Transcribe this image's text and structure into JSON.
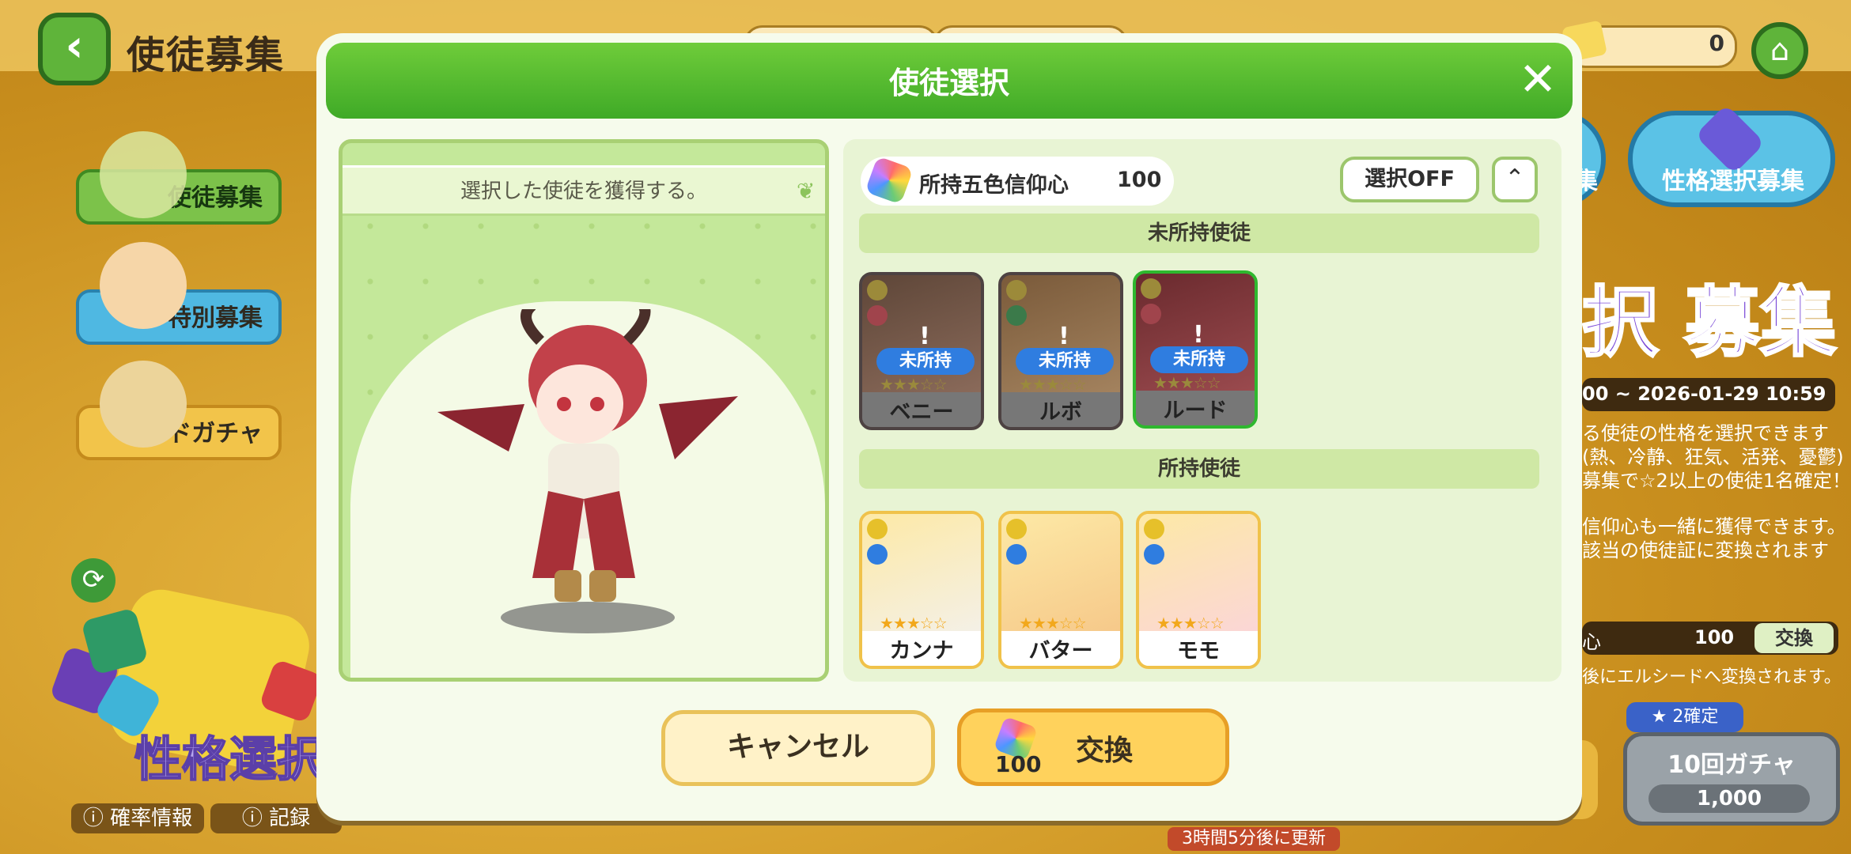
{
  "background": {
    "page_title": "使徒募集",
    "ticket_count": "0",
    "side_tabs": [
      "使徒募集",
      "特別募集",
      "カードガチャ"
    ],
    "gacha_banner_label": "性格選択",
    "bottom_links": [
      "確率情報",
      "記録"
    ],
    "refresh_note": "3時間5分後に更新",
    "right_button_label": "性格選択募集",
    "right_button_partial": "集",
    "big_banner_text": "択 募集",
    "period_text": "00 ~ 2026-01-29 10:59",
    "desc_lines": [
      "る使徒の性格を選択できます",
      "(熱、冷静、狂気、活発、憂鬱)",
      "募集で☆2以上の使徒1名確定！",
      "信仰心も一緒に獲得できます。",
      "該当の使徒証に変換されます"
    ],
    "exchange_row_partial": "心",
    "exchange_value": "100",
    "exchange_button": "交換",
    "convert_note": "後にエルシードへ変換されます。",
    "guarantee_badge": "2確定",
    "ten_gacha_label": "10回ガチャ",
    "ten_gacha_cost": "1,000"
  },
  "modal": {
    "title": "使徒選択",
    "close_icon": "close-icon",
    "preview_caption": "選択した使徒を獲得する。",
    "gem_label": "所持五色信仰心",
    "gem_count": "100",
    "select_off_label": "選択OFF",
    "collapse_icon": "double-chevron-up-icon",
    "unowned_section": "未所持使徒",
    "owned_section": "所持使徒",
    "unowned_badge": "未所持",
    "unowned_cards": [
      {
        "name": "ベニー",
        "stars": "★★★☆☆"
      },
      {
        "name": "ルボ",
        "stars": "★★★☆☆"
      },
      {
        "name": "ルード",
        "stars": "★★★☆☆"
      }
    ],
    "owned_cards": [
      {
        "name": "カンナ",
        "stars": "★★★☆☆"
      },
      {
        "name": "バター",
        "stars": "★★★☆☆"
      },
      {
        "name": "モモ",
        "stars": "★★★☆☆"
      }
    ],
    "cancel_label": "キャンセル",
    "exchange_label": "交換",
    "exchange_cost": "100"
  },
  "colors": {
    "header_green": "#3faa27",
    "badge_blue": "#2f7de0",
    "exchange_orange": "#ffd25c"
  }
}
